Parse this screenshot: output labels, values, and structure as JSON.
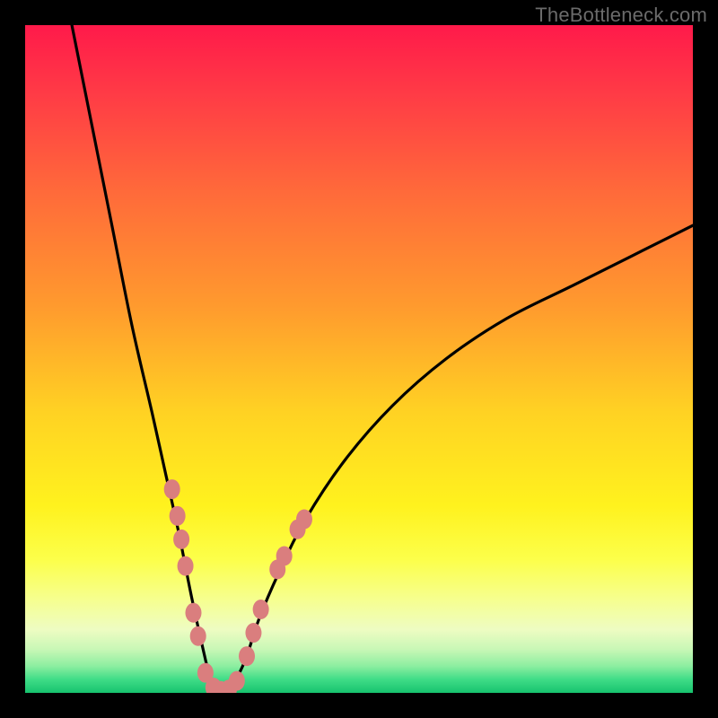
{
  "watermark": "TheBottleneck.com",
  "chart_data": {
    "type": "line",
    "title": "",
    "xlabel": "",
    "ylabel": "",
    "xlim": [
      0,
      100
    ],
    "ylim": [
      0,
      100
    ],
    "grid": false,
    "description": "Asymmetric V-shaped bottleneck curve over vertical red-to-green gradient. Minimum (0% bottleneck) occurs around x≈27–31. Left branch rises steeply to ~100 at x≈7; right branch rises more gently to ~70 at x≈100.",
    "series": [
      {
        "name": "bottleneck-curve",
        "x": [
          7,
          10,
          13,
          16,
          19,
          21,
          23,
          25,
          27,
          28,
          29,
          30,
          31,
          33,
          35,
          38,
          42,
          48,
          55,
          63,
          72,
          82,
          92,
          100
        ],
        "y": [
          100,
          85,
          70,
          55,
          42,
          33,
          24,
          14,
          5,
          1,
          0,
          0,
          1,
          5,
          11,
          18,
          26,
          35,
          43,
          50,
          56,
          61,
          66,
          70
        ]
      }
    ],
    "markers": {
      "name": "salmon-dots",
      "color": "#da7e7e",
      "points": [
        {
          "x": 22.0,
          "y": 30.5
        },
        {
          "x": 22.8,
          "y": 26.5
        },
        {
          "x": 23.4,
          "y": 23.0
        },
        {
          "x": 24.0,
          "y": 19.0
        },
        {
          "x": 25.2,
          "y": 12.0
        },
        {
          "x": 25.9,
          "y": 8.5
        },
        {
          "x": 27.0,
          "y": 3.0
        },
        {
          "x": 28.2,
          "y": 0.8
        },
        {
          "x": 29.3,
          "y": 0.3
        },
        {
          "x": 30.5,
          "y": 0.5
        },
        {
          "x": 31.7,
          "y": 1.8
        },
        {
          "x": 33.2,
          "y": 5.5
        },
        {
          "x": 34.2,
          "y": 9.0
        },
        {
          "x": 35.3,
          "y": 12.5
        },
        {
          "x": 37.8,
          "y": 18.5
        },
        {
          "x": 38.8,
          "y": 20.5
        },
        {
          "x": 40.8,
          "y": 24.5
        },
        {
          "x": 41.8,
          "y": 26.0
        }
      ]
    },
    "gradient_stops": [
      {
        "offset": 0.0,
        "color": "#ff1a4a"
      },
      {
        "offset": 0.1,
        "color": "#ff3a46"
      },
      {
        "offset": 0.25,
        "color": "#ff6a3a"
      },
      {
        "offset": 0.42,
        "color": "#ff9a2e"
      },
      {
        "offset": 0.58,
        "color": "#ffd223"
      },
      {
        "offset": 0.72,
        "color": "#fff21e"
      },
      {
        "offset": 0.8,
        "color": "#fcff4a"
      },
      {
        "offset": 0.86,
        "color": "#f6ff8f"
      },
      {
        "offset": 0.905,
        "color": "#eefcc2"
      },
      {
        "offset": 0.935,
        "color": "#c8f7b6"
      },
      {
        "offset": 0.96,
        "color": "#8ceea0"
      },
      {
        "offset": 0.98,
        "color": "#3fdc87"
      },
      {
        "offset": 1.0,
        "color": "#17c36e"
      }
    ]
  }
}
